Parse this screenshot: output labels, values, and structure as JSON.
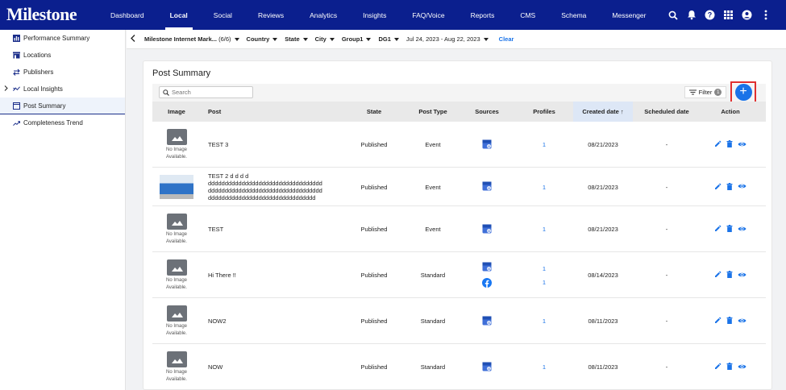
{
  "app": {
    "logo": "Milestone",
    "nav": [
      "Dashboard",
      "Local",
      "Social",
      "Reviews",
      "Analytics",
      "Insights",
      "FAQ/Voice",
      "Reports",
      "CMS",
      "Schema",
      "Messenger"
    ],
    "nav_active": "Local",
    "top_icons": [
      "search-icon",
      "bell-icon",
      "help-icon",
      "apps-grid-icon",
      "account-icon",
      "more-vertical-icon"
    ]
  },
  "sidebar": {
    "items": [
      {
        "label": "Performance Summary",
        "icon": "bar-chart-icon"
      },
      {
        "label": "Locations",
        "icon": "store-icon"
      },
      {
        "label": "Publishers",
        "icon": "swap-icon"
      },
      {
        "label": "Local Insights",
        "icon": "trend-icon"
      },
      {
        "label": "Post Summary",
        "icon": "window-icon"
      },
      {
        "label": "Completeness Trend",
        "icon": "trending-up-icon"
      }
    ],
    "active": "Post Summary"
  },
  "filters": {
    "account": "Milestone Internet Mark...",
    "account_count": "(6/6)",
    "country": "Country",
    "state": "State",
    "city": "City",
    "group": "Group1",
    "dg": "DG1",
    "date_range": "Jul 24, 2023 - Aug 22, 2023",
    "clear": "Clear"
  },
  "card": {
    "title": "Post Summary",
    "search_placeholder": "Search",
    "filter_label": "Filter",
    "filter_count": "1",
    "add_label": "+"
  },
  "table": {
    "headers": {
      "image": "Image",
      "post": "Post",
      "state": "State",
      "post_type": "Post Type",
      "sources": "Sources",
      "profiles": "Profiles",
      "created": "Created date ↑",
      "scheduled": "Scheduled date",
      "action": "Action"
    },
    "no_image": "No Image Available.",
    "rows": [
      {
        "post": "TEST 3",
        "state": "Published",
        "type": "Event",
        "profiles": [
          "1"
        ],
        "created": "08/21/2023",
        "scheduled": "-",
        "image": "none"
      },
      {
        "post": "TEST 2 d d d d\ndddddddddddddddddddddddddddddddddd\ndddddddddddddddddddddddddddddddddd\ndddddddddddddddddddddddddddddddd",
        "state": "Published",
        "type": "Event",
        "profiles": [
          "1"
        ],
        "created": "08/21/2023",
        "scheduled": "-",
        "image": "photo"
      },
      {
        "post": "TEST",
        "state": "Published",
        "type": "Event",
        "profiles": [
          "1"
        ],
        "created": "08/21/2023",
        "scheduled": "-",
        "image": "none"
      },
      {
        "post": "Hi There !!",
        "state": "Published",
        "type": "Standard",
        "profiles": [
          "1",
          "1"
        ],
        "created": "08/14/2023",
        "scheduled": "-",
        "image": "none"
      },
      {
        "post": "NOW2",
        "state": "Published",
        "type": "Standard",
        "profiles": [
          "1"
        ],
        "created": "08/11/2023",
        "scheduled": "-",
        "image": "none"
      },
      {
        "post": "NOW",
        "state": "Published",
        "type": "Standard",
        "profiles": [
          "1"
        ],
        "created": "08/11/2023",
        "scheduled": "-",
        "image": "none"
      }
    ]
  },
  "colors": {
    "nav_bg": "#0b1f8e",
    "accent": "#1a73e8",
    "highlight": "#e03030"
  }
}
